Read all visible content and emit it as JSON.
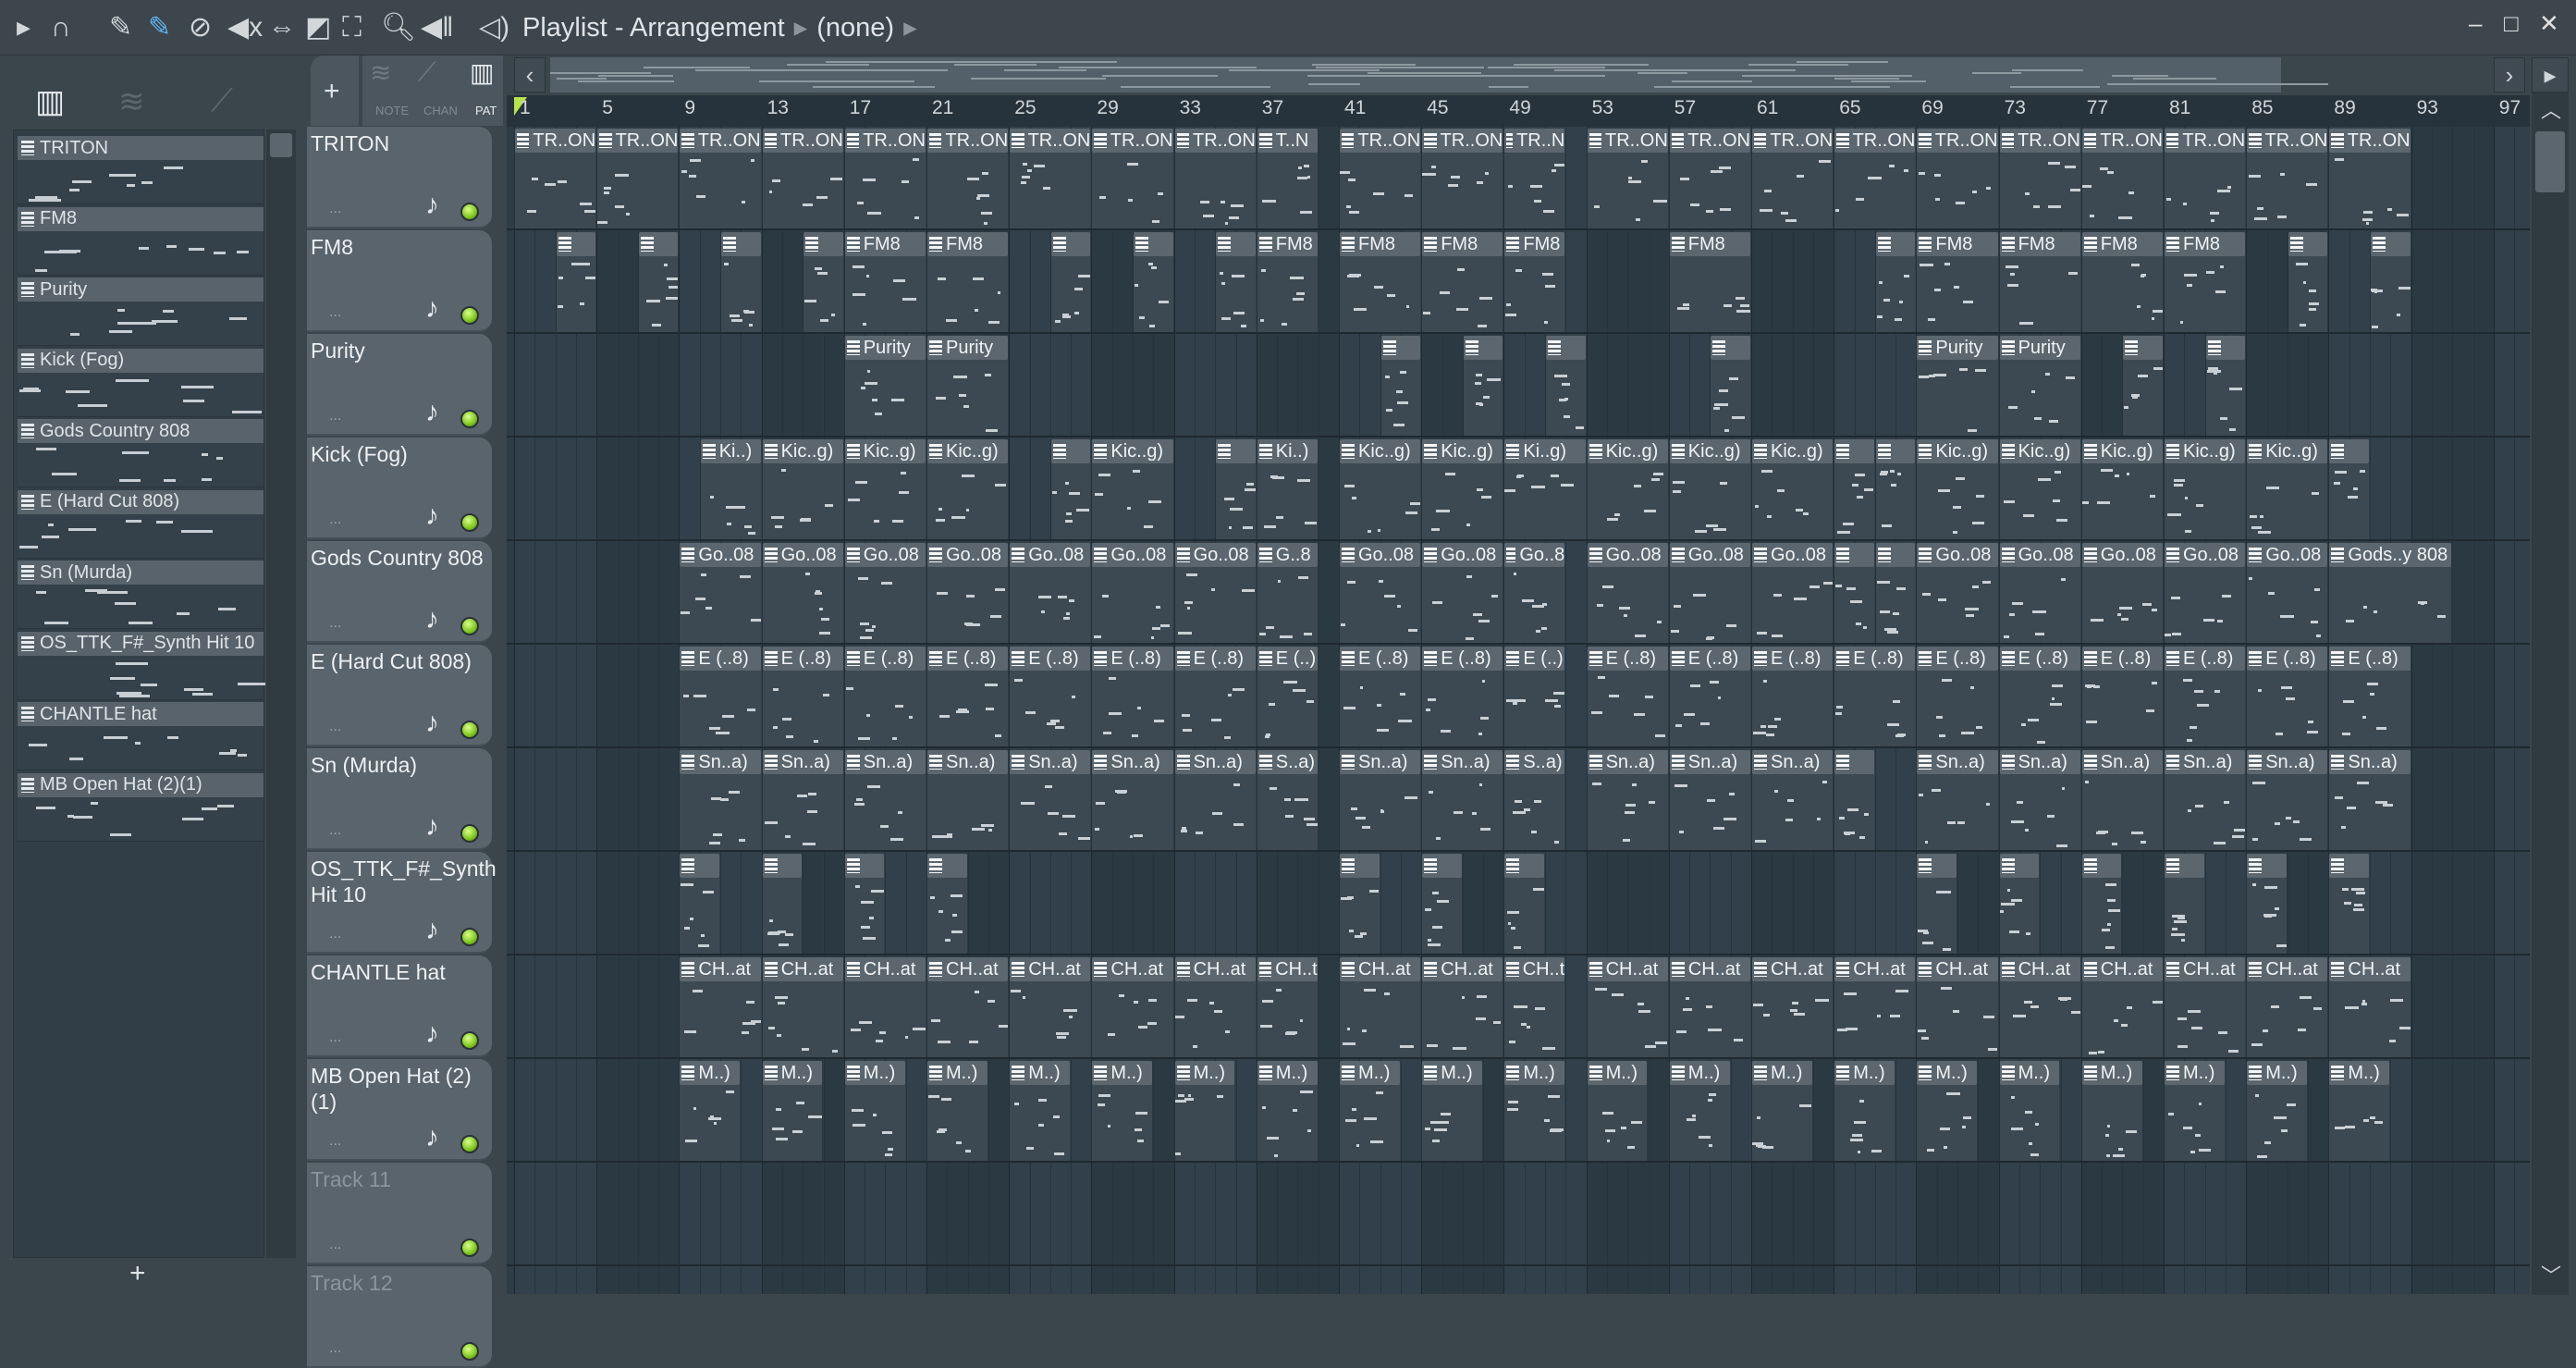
{
  "titlebar": {
    "title": "Playlist - Arrangement",
    "pattern": "(none)",
    "icons": [
      "play-arrow-icon",
      "magnet-icon",
      "pencil-icon",
      "paint-icon",
      "delete-icon",
      "mute-icon",
      "slip-icon",
      "slice-icon",
      "select-icon",
      "zoom-icon",
      "playback-icon",
      "speaker-icon"
    ]
  },
  "picker": {
    "tabs": [
      "NOTE",
      "CHAN",
      "PAT"
    ],
    "add_label": "+",
    "channels": [
      "TRITON",
      "FM8",
      "Purity",
      "Kick (Fog)",
      "Gods Country 808",
      "E (Hard Cut 808)",
      "Sn (Murda)",
      "OS_TTK_F#_Synth Hit 10",
      "CHANTLE hat",
      "MB Open Hat (2)(1)"
    ]
  },
  "ruler": {
    "bars": [
      "1",
      "5",
      "9",
      "13",
      "17",
      "21",
      "25",
      "29",
      "33",
      "37",
      "41",
      "45",
      "49",
      "53",
      "57",
      "61",
      "65",
      "69",
      "73",
      "77",
      "81",
      "85",
      "89",
      "93",
      "97"
    ]
  },
  "tracks": [
    {
      "name": "TRITON",
      "clips": [
        [
          1,
          4,
          "TR..ON"
        ],
        [
          5,
          4,
          "TR..ON"
        ],
        [
          9,
          4,
          "TR..ON"
        ],
        [
          13,
          4,
          "TR..ON"
        ],
        [
          17,
          4,
          "TR..ON"
        ],
        [
          21,
          4,
          "TR..ON"
        ],
        [
          25,
          4,
          "TR..ON"
        ],
        [
          29,
          4,
          "TR..ON"
        ],
        [
          33,
          4,
          "TR..ON"
        ],
        [
          37,
          3,
          "T..N"
        ],
        [
          41,
          4,
          "TR..ON"
        ],
        [
          45,
          4,
          "TR..ON"
        ],
        [
          49,
          3,
          "TR..N"
        ],
        [
          53,
          4,
          "TR..ON"
        ],
        [
          57,
          4,
          "TR..ON"
        ],
        [
          61,
          4,
          "TR..ON"
        ],
        [
          65,
          4,
          "TR..ON"
        ],
        [
          69,
          4,
          "TR..ON"
        ],
        [
          73,
          4,
          "TR..ON"
        ],
        [
          77,
          4,
          "TR..ON"
        ],
        [
          81,
          4,
          "TR..ON"
        ],
        [
          85,
          4,
          "TR..ON"
        ],
        [
          89,
          4,
          "TR..ON"
        ]
      ]
    },
    {
      "name": "FM8",
      "clips": [
        [
          3,
          2,
          ""
        ],
        [
          7,
          2,
          ""
        ],
        [
          11,
          2,
          ""
        ],
        [
          15,
          2,
          ""
        ],
        [
          17,
          4,
          "FM8"
        ],
        [
          21,
          4,
          "FM8"
        ],
        [
          27,
          2,
          ""
        ],
        [
          31,
          2,
          ""
        ],
        [
          35,
          2,
          ""
        ],
        [
          37,
          3,
          "FM8"
        ],
        [
          41,
          4,
          "FM8"
        ],
        [
          45,
          4,
          "FM8"
        ],
        [
          49,
          3,
          "FM8"
        ],
        [
          57,
          4,
          "FM8"
        ],
        [
          67,
          2,
          ""
        ],
        [
          69,
          4,
          "FM8"
        ],
        [
          73,
          4,
          "FM8"
        ],
        [
          77,
          4,
          "FM8"
        ],
        [
          81,
          4,
          "FM8"
        ],
        [
          87,
          2,
          ""
        ],
        [
          91,
          2,
          ""
        ]
      ]
    },
    {
      "name": "Purity",
      "clips": [
        [
          17,
          4,
          "Purity"
        ],
        [
          21,
          4,
          "Purity"
        ],
        [
          43,
          2,
          ""
        ],
        [
          47,
          2,
          ""
        ],
        [
          51,
          2,
          ""
        ],
        [
          59,
          2,
          ""
        ],
        [
          69,
          4,
          "Purity"
        ],
        [
          73,
          4,
          "Purity"
        ],
        [
          79,
          2,
          ""
        ],
        [
          83,
          2,
          ""
        ]
      ]
    },
    {
      "name": "Kick (Fog)",
      "clips": [
        [
          10,
          3,
          "Ki..)"
        ],
        [
          13,
          4,
          "Kic..g)"
        ],
        [
          17,
          4,
          "Kic..g)"
        ],
        [
          21,
          4,
          "Kic..g)"
        ],
        [
          27,
          2,
          ""
        ],
        [
          29,
          4,
          "Kic..g)"
        ],
        [
          35,
          2,
          ""
        ],
        [
          37,
          3,
          "Ki..)"
        ],
        [
          41,
          4,
          "Kic..g)"
        ],
        [
          45,
          4,
          "Kic..g)"
        ],
        [
          49,
          4,
          "Ki..g)"
        ],
        [
          53,
          4,
          "Kic..g)"
        ],
        [
          57,
          4,
          "Kic..g)"
        ],
        [
          61,
          4,
          "Kic..g)"
        ],
        [
          65,
          2,
          ""
        ],
        [
          67,
          2,
          ""
        ],
        [
          69,
          4,
          "Kic..g)"
        ],
        [
          73,
          4,
          "Kic..g)"
        ],
        [
          77,
          4,
          "Kic..g)"
        ],
        [
          81,
          4,
          "Kic..g)"
        ],
        [
          85,
          4,
          "Kic..g)"
        ],
        [
          89,
          2,
          ""
        ]
      ]
    },
    {
      "name": "Gods Country 808",
      "clips": [
        [
          9,
          4,
          "Go..08"
        ],
        [
          13,
          4,
          "Go..08"
        ],
        [
          17,
          4,
          "Go..08"
        ],
        [
          21,
          4,
          "Go..08"
        ],
        [
          25,
          4,
          "Go..08"
        ],
        [
          29,
          4,
          "Go..08"
        ],
        [
          33,
          4,
          "Go..08"
        ],
        [
          37,
          3,
          "G..8"
        ],
        [
          41,
          4,
          "Go..08"
        ],
        [
          45,
          4,
          "Go..08"
        ],
        [
          49,
          3,
          "Go..8"
        ],
        [
          53,
          4,
          "Go..08"
        ],
        [
          57,
          4,
          "Go..08"
        ],
        [
          61,
          4,
          "Go..08"
        ],
        [
          65,
          2,
          ""
        ],
        [
          67,
          2,
          ""
        ],
        [
          69,
          4,
          "Go..08"
        ],
        [
          73,
          4,
          "Go..08"
        ],
        [
          77,
          4,
          "Go..08"
        ],
        [
          81,
          4,
          "Go..08"
        ],
        [
          85,
          4,
          "Go..08"
        ],
        [
          89,
          6,
          "Gods..y 808"
        ]
      ]
    },
    {
      "name": "E (Hard Cut 808)",
      "clips": [
        [
          9,
          4,
          "E (..8)"
        ],
        [
          13,
          4,
          "E (..8)"
        ],
        [
          17,
          4,
          "E (..8)"
        ],
        [
          21,
          4,
          "E (..8)"
        ],
        [
          25,
          4,
          "E (..8)"
        ],
        [
          29,
          4,
          "E (..8)"
        ],
        [
          33,
          4,
          "E (..8)"
        ],
        [
          37,
          3,
          "E (..)"
        ],
        [
          41,
          4,
          "E (..8)"
        ],
        [
          45,
          4,
          "E (..8)"
        ],
        [
          49,
          3,
          "E (..)"
        ],
        [
          53,
          4,
          "E (..8)"
        ],
        [
          57,
          4,
          "E (..8)"
        ],
        [
          61,
          4,
          "E (..8)"
        ],
        [
          65,
          4,
          "E (..8)"
        ],
        [
          69,
          4,
          "E (..8)"
        ],
        [
          73,
          4,
          "E (..8)"
        ],
        [
          77,
          4,
          "E (..8)"
        ],
        [
          81,
          4,
          "E (..8)"
        ],
        [
          85,
          4,
          "E (..8)"
        ],
        [
          89,
          4,
          "E (..8)"
        ]
      ]
    },
    {
      "name": "Sn (Murda)",
      "clips": [
        [
          9,
          4,
          "Sn..a)"
        ],
        [
          13,
          4,
          "Sn..a)"
        ],
        [
          17,
          4,
          "Sn..a)"
        ],
        [
          21,
          4,
          "Sn..a)"
        ],
        [
          25,
          4,
          "Sn..a)"
        ],
        [
          29,
          4,
          "Sn..a)"
        ],
        [
          33,
          4,
          "Sn..a)"
        ],
        [
          37,
          3,
          "S..a)"
        ],
        [
          41,
          4,
          "Sn..a)"
        ],
        [
          45,
          4,
          "Sn..a)"
        ],
        [
          49,
          3,
          "S..a)"
        ],
        [
          53,
          4,
          "Sn..a)"
        ],
        [
          57,
          4,
          "Sn..a)"
        ],
        [
          61,
          4,
          "Sn..a)"
        ],
        [
          65,
          2,
          ""
        ],
        [
          69,
          4,
          "Sn..a)"
        ],
        [
          73,
          4,
          "Sn..a)"
        ],
        [
          77,
          4,
          "Sn..a)"
        ],
        [
          81,
          4,
          "Sn..a)"
        ],
        [
          85,
          4,
          "Sn..a)"
        ],
        [
          89,
          4,
          "Sn..a)"
        ]
      ]
    },
    {
      "name": "OS_TTK_F#_Synth Hit 10",
      "clips": [
        [
          9,
          2,
          ""
        ],
        [
          13,
          2,
          ""
        ],
        [
          17,
          2,
          ""
        ],
        [
          21,
          2,
          ""
        ],
        [
          41,
          2,
          ""
        ],
        [
          45,
          2,
          ""
        ],
        [
          49,
          2,
          ""
        ],
        [
          69,
          2,
          ""
        ],
        [
          73,
          2,
          ""
        ],
        [
          77,
          2,
          ""
        ],
        [
          81,
          2,
          ""
        ],
        [
          85,
          2,
          ""
        ],
        [
          89,
          2,
          ""
        ]
      ]
    },
    {
      "name": "CHANTLE hat",
      "clips": [
        [
          9,
          4,
          "CH..at"
        ],
        [
          13,
          4,
          "CH..at"
        ],
        [
          17,
          4,
          "CH..at"
        ],
        [
          21,
          4,
          "CH..at"
        ],
        [
          25,
          4,
          "CH..at"
        ],
        [
          29,
          4,
          "CH..at"
        ],
        [
          33,
          4,
          "CH..at"
        ],
        [
          37,
          3,
          "CH..t"
        ],
        [
          41,
          4,
          "CH..at"
        ],
        [
          45,
          4,
          "CH..at"
        ],
        [
          49,
          3,
          "CH..t"
        ],
        [
          53,
          4,
          "CH..at"
        ],
        [
          57,
          4,
          "CH..at"
        ],
        [
          61,
          4,
          "CH..at"
        ],
        [
          65,
          4,
          "CH..at"
        ],
        [
          69,
          4,
          "CH..at"
        ],
        [
          73,
          4,
          "CH..at"
        ],
        [
          77,
          4,
          "CH..at"
        ],
        [
          81,
          4,
          "CH..at"
        ],
        [
          85,
          4,
          "CH..at"
        ],
        [
          89,
          4,
          "CH..at"
        ]
      ]
    },
    {
      "name": "MB Open Hat (2)(1)",
      "clips": [
        [
          9,
          3,
          "M..)"
        ],
        [
          13,
          3,
          "M..)"
        ],
        [
          17,
          3,
          "M..)"
        ],
        [
          21,
          3,
          "M..)"
        ],
        [
          25,
          3,
          "M..)"
        ],
        [
          29,
          3,
          "M..)"
        ],
        [
          33,
          3,
          "M..)"
        ],
        [
          37,
          3,
          "M..)"
        ],
        [
          41,
          3,
          "M..)"
        ],
        [
          45,
          3,
          "M..)"
        ],
        [
          49,
          3,
          "M..)"
        ],
        [
          53,
          3,
          "M..)"
        ],
        [
          57,
          3,
          "M..)"
        ],
        [
          61,
          3,
          "M..)"
        ],
        [
          65,
          3,
          "M..)"
        ],
        [
          69,
          3,
          "M..)"
        ],
        [
          73,
          3,
          "M..)"
        ],
        [
          77,
          3,
          "M..)"
        ],
        [
          81,
          3,
          "M..)"
        ],
        [
          85,
          3,
          "M..)"
        ],
        [
          89,
          3,
          "M..)"
        ]
      ]
    },
    {
      "name": "Track 11",
      "empty": true,
      "clips": []
    },
    {
      "name": "Track 12",
      "empty": true,
      "clips": []
    }
  ],
  "colors": {
    "led": "#7fc51c",
    "clip_header": "#5b666e",
    "grid_bg": "#2e3c46"
  }
}
